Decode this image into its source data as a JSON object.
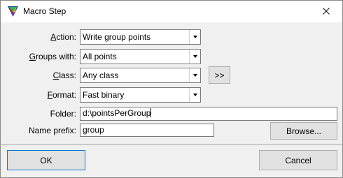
{
  "window": {
    "title": "Macro Step",
    "app_icon": "terrascan-tri-color-icon",
    "close_icon": "close-icon"
  },
  "form": {
    "action": {
      "label_accel": "A",
      "label_rest": "ction:",
      "value": "Write group points"
    },
    "groups_with": {
      "label_accel": "G",
      "label_rest": "roups with:",
      "value": "All points"
    },
    "class": {
      "label_accel": "C",
      "label_rest": "lass:",
      "value": "Any class"
    },
    "format": {
      "label_accel": "F",
      "label_rest": "ormat:",
      "value": "Fast binary"
    },
    "more_button": ">>",
    "folder": {
      "label": "Folder:",
      "value": "d:\\pointsPerGroup"
    },
    "name_prefix": {
      "label": "Name prefix:",
      "value": "group"
    },
    "browse_button": "Browse..."
  },
  "footer": {
    "ok_label": "OK",
    "cancel_label": "Cancel"
  }
}
